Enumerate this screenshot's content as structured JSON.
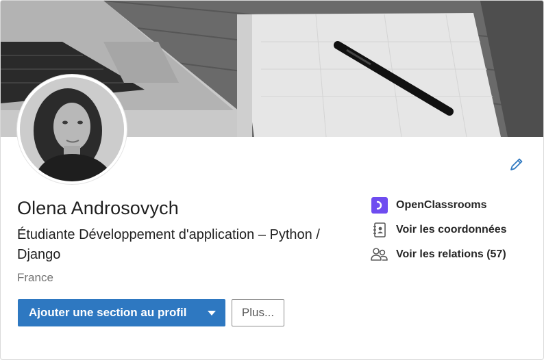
{
  "profile": {
    "name": "Olena Androsovych",
    "headline": "Étudiante Développement d'application – Python / Django",
    "location": "France"
  },
  "actions": {
    "add_section_label": "Ajouter une section au profil",
    "more_label": "Plus..."
  },
  "side": {
    "company": "OpenClassrooms",
    "contact_info": "Voir les coordonnées",
    "connections": "Voir les relations (57)"
  },
  "icons": {
    "edit": "pencil-icon",
    "company": "openclassrooms-logo",
    "contact": "address-book-icon",
    "connections": "people-icon"
  },
  "colors": {
    "primary": "#2e78c1",
    "brand_company": "#6e4cf0"
  }
}
